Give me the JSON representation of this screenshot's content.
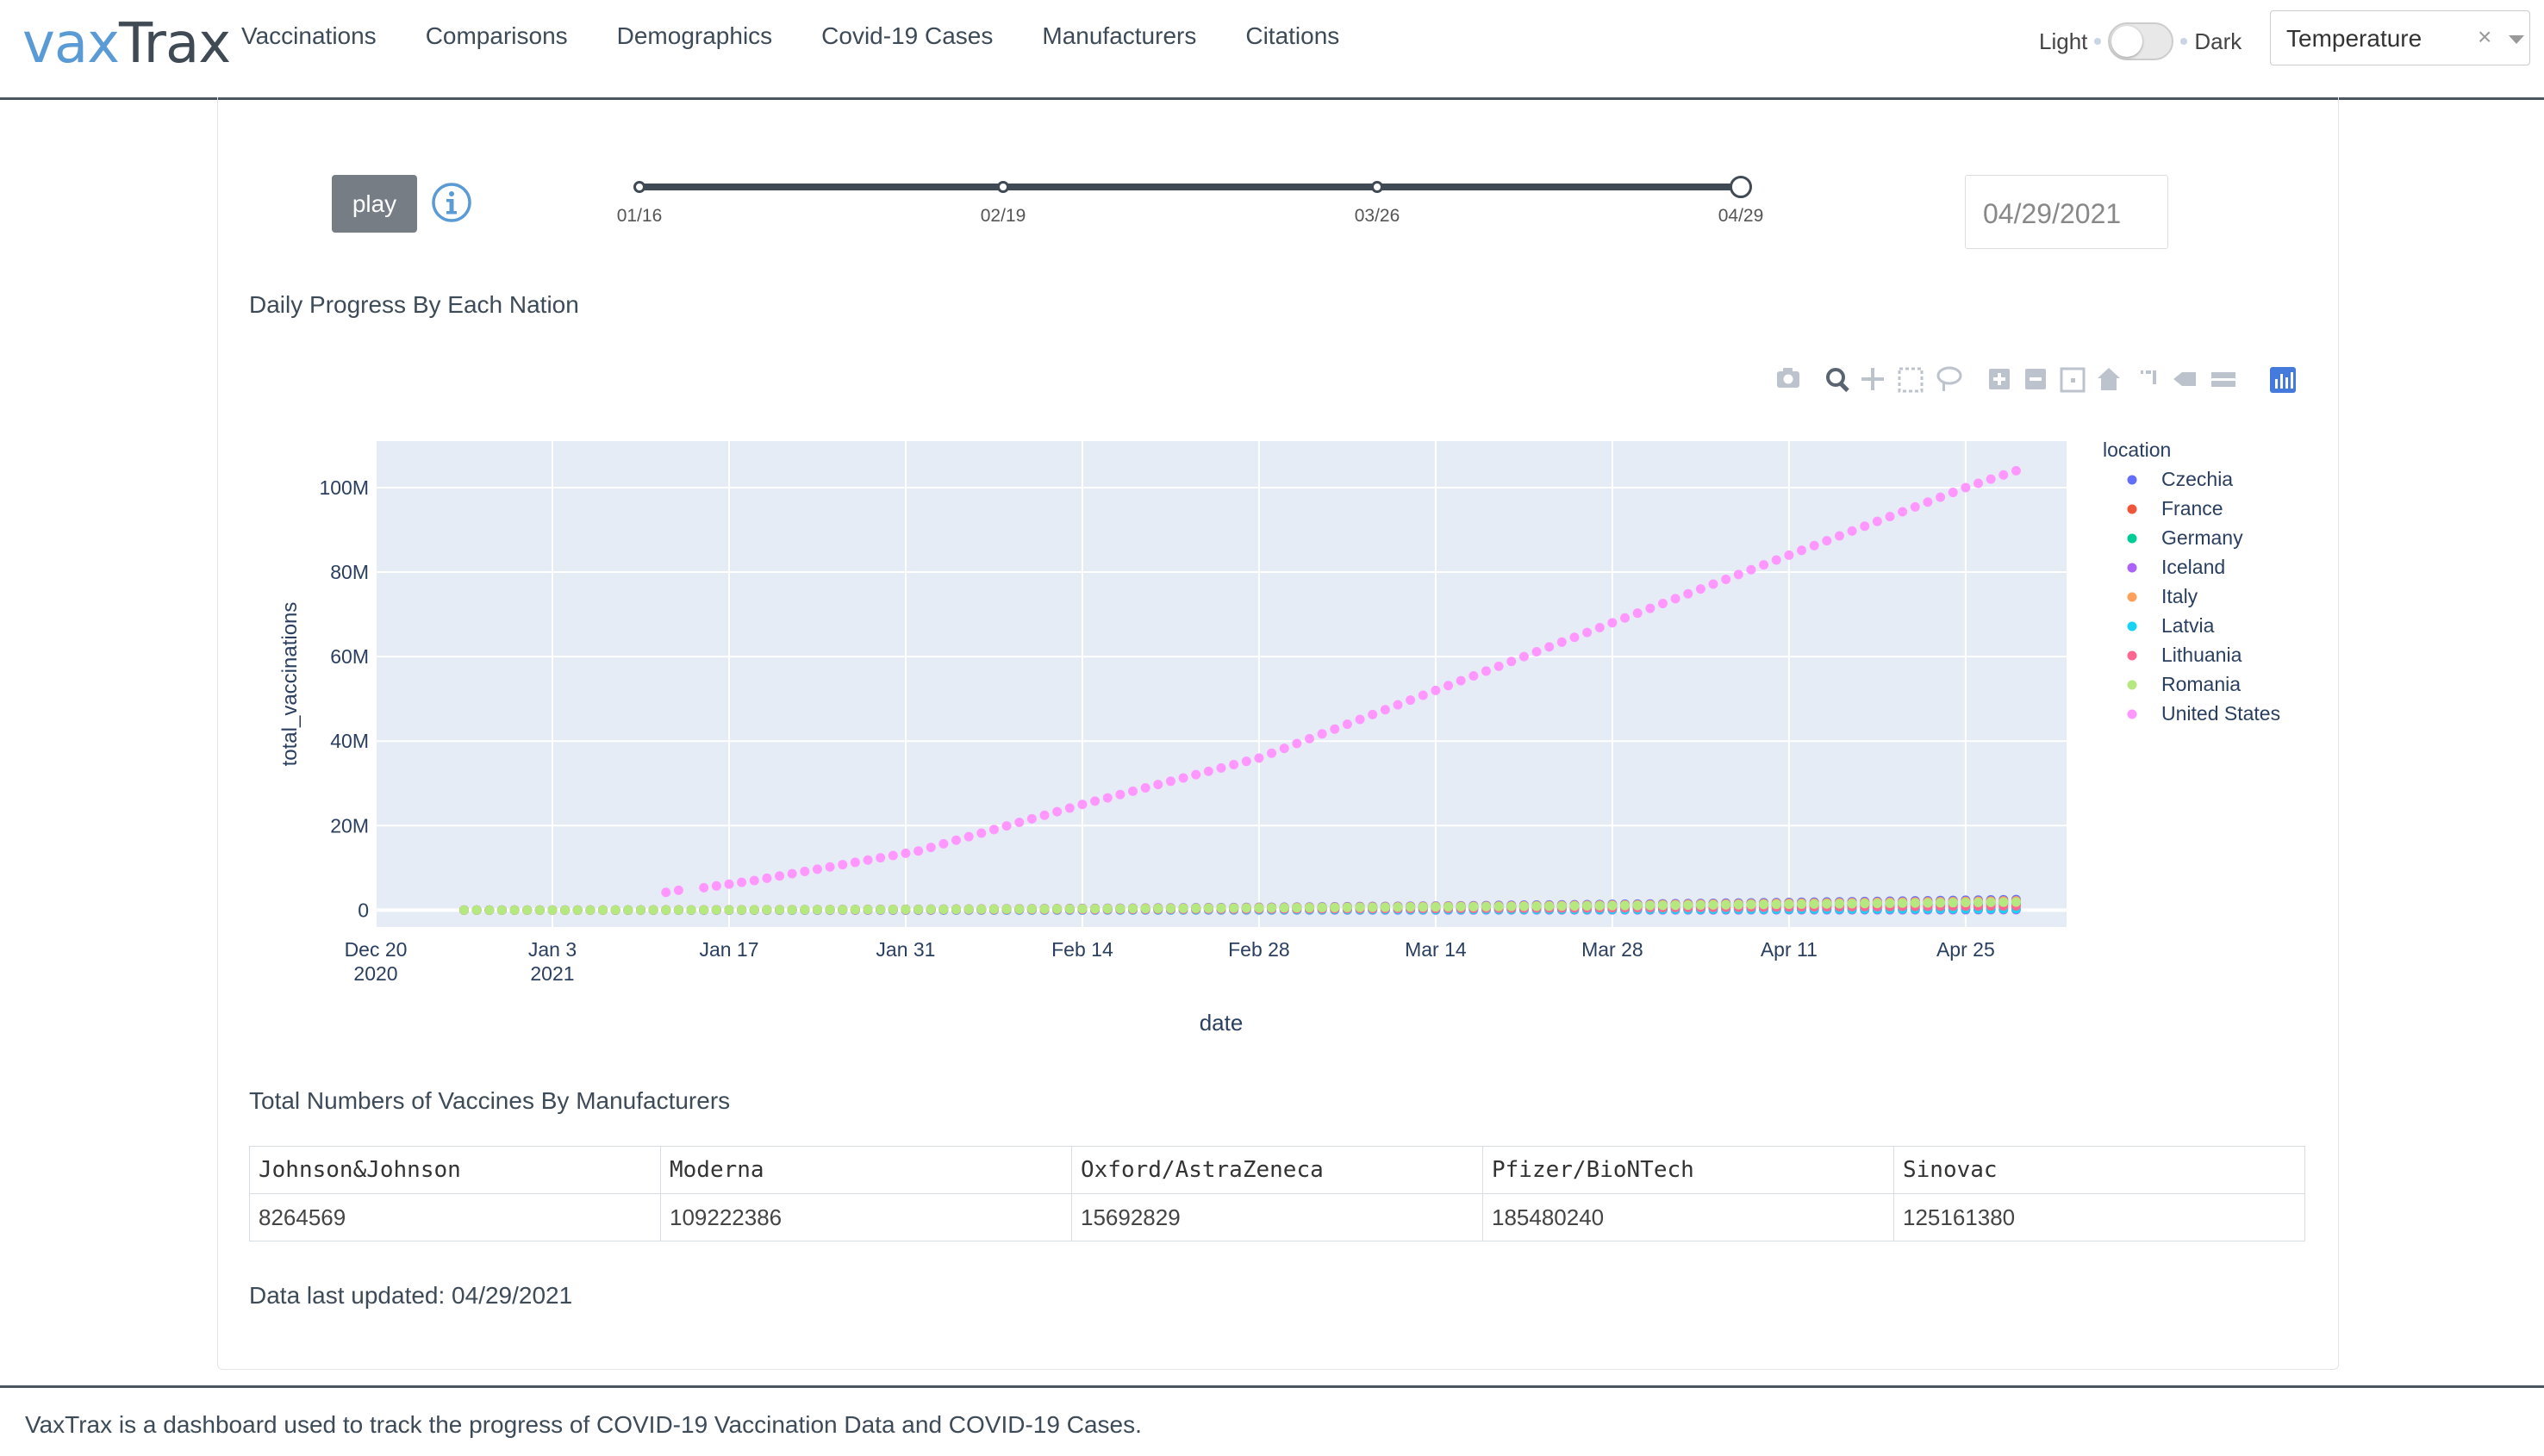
{
  "brand": {
    "logo_part1": "vax",
    "logo_part2": "Trax"
  },
  "nav": {
    "items": [
      "Vaccinations",
      "Comparisons",
      "Demographics",
      "Covid-19 Cases",
      "Manufacturers",
      "Citations"
    ]
  },
  "theme": {
    "light_label": "Light",
    "dark_label": "Dark",
    "dark_enabled": false
  },
  "variable_select": {
    "value": "Temperature",
    "clear_symbol": "×"
  },
  "controls": {
    "play_label": "play",
    "info_icon": "info-circle-icon",
    "slider_marks": [
      "01/16",
      "02/19",
      "03/26",
      "04/29"
    ],
    "slider_value": "04/29",
    "date_value": "04/29/2021"
  },
  "sections": {
    "chart_title": "Daily Progress By Each Nation",
    "table_title": "Total Numbers of Vaccines By Manufacturers",
    "last_updated": "Data last updated: 04/29/2021"
  },
  "modebar_icons": [
    "camera-icon",
    "zoom-icon",
    "pan-icon",
    "box-select-icon",
    "lasso-icon",
    "zoom-in-icon",
    "zoom-out-icon",
    "autoscale-icon",
    "reset-axes-icon",
    "spike-lines-icon",
    "hover-closest-icon",
    "hover-compare-icon",
    "plotly-logo-icon"
  ],
  "chart_data": {
    "type": "scatter",
    "xlabel": "date",
    "ylabel": "total_vaccinations",
    "x_tick_labels": [
      "Dec 20\n2020",
      "Jan 3\n2021",
      "Jan 17",
      "Jan 31",
      "Feb 14",
      "Feb 28",
      "Mar 14",
      "Mar 28",
      "Apr 11",
      "Apr 25"
    ],
    "x_tick_dates": [
      "2020-12-20",
      "2021-01-03",
      "2021-01-17",
      "2021-01-31",
      "2021-02-14",
      "2021-02-28",
      "2021-03-14",
      "2021-03-28",
      "2021-04-11",
      "2021-04-25"
    ],
    "y_tick_labels": [
      "0",
      "20M",
      "40M",
      "60M",
      "80M",
      "100M"
    ],
    "y_tick_values": [
      0,
      20000000,
      40000000,
      60000000,
      80000000,
      100000000
    ],
    "xlim": [
      "2020-12-20",
      "2021-05-03"
    ],
    "ylim": [
      -4000000,
      111000000
    ],
    "legend_title": "location",
    "legend_position": "right",
    "colors": {
      "plot_bg": "#e5ecf6",
      "grid": "#ffffff"
    },
    "series": [
      {
        "name": "Czechia",
        "color": "#636efa",
        "start": "2020-12-27",
        "end": "2021-04-29",
        "values_start": 0,
        "values_end": 2500000
      },
      {
        "name": "France",
        "color": "#ef553b",
        "start": "2020-12-27",
        "end": "2021-04-29",
        "values_start": 0,
        "values_end": 1800000
      },
      {
        "name": "Germany",
        "color": "#00cc96",
        "start": "2020-12-27",
        "end": "2021-04-29",
        "values_start": 0,
        "values_end": 1500000
      },
      {
        "name": "Iceland",
        "color": "#ab63fa",
        "start": "2020-12-27",
        "end": "2021-04-29",
        "values_start": 0,
        "values_end": 100000
      },
      {
        "name": "Italy",
        "color": "#ffa15a",
        "start": "2020-12-27",
        "end": "2021-04-29",
        "values_start": 0,
        "values_end": 2200000
      },
      {
        "name": "Latvia",
        "color": "#19d3f3",
        "start": "2020-12-27",
        "end": "2021-04-29",
        "values_start": 0,
        "values_end": 300000
      },
      {
        "name": "Lithuania",
        "color": "#ff6692",
        "start": "2020-12-27",
        "end": "2021-04-29",
        "values_start": 0,
        "values_end": 1000000
      },
      {
        "name": "Romania",
        "color": "#b6e880",
        "start": "2020-12-27",
        "end": "2021-04-29",
        "values_start": 0,
        "values_end": 1900000
      },
      {
        "name": "United States",
        "color": "#ff97ff",
        "start": "2021-01-12",
        "end": "2021-04-29",
        "points": [
          [
            "2021-01-12",
            4200000
          ],
          [
            "2021-01-13",
            4700000
          ],
          [
            "2021-01-15",
            5300000
          ],
          [
            "2021-01-19",
            7000000
          ],
          [
            "2021-02-01",
            14000000
          ],
          [
            "2021-02-14",
            25000000
          ],
          [
            "2021-02-28",
            36000000
          ],
          [
            "2021-03-14",
            52000000
          ],
          [
            "2021-03-28",
            68000000
          ],
          [
            "2021-04-11",
            84000000
          ],
          [
            "2021-04-25",
            100000000
          ],
          [
            "2021-04-29",
            104000000
          ]
        ]
      }
    ]
  },
  "manufacturers_table": {
    "headers": [
      "Johnson&Johnson",
      "Moderna",
      "Oxford/AstraZeneca",
      "Pfizer/BioNTech",
      "Sinovac"
    ],
    "values": [
      "8264569",
      "109222386",
      "15692829",
      "185480240",
      "125161380"
    ]
  },
  "footer": {
    "text": "VaxTrax is a dashboard used to track the progress of COVID-19 Vaccination Data and COVID-19 Cases."
  }
}
